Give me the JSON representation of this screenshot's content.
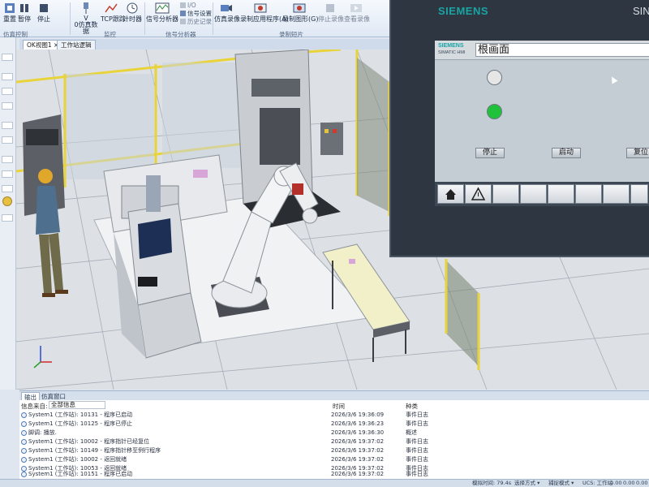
{
  "ribbon": {
    "buttons": [
      "重置",
      "暂停",
      "停止",
      "V\n0仿真数据",
      "TCP跟踪",
      "计时器",
      "信号分析器",
      "仿真录像",
      "录制应用程序(A)",
      "录制图形(G)",
      "停止录像",
      "查看录像"
    ],
    "small_items": [
      "I/O",
      "信号设置",
      "历史记录"
    ],
    "groups": [
      "仿真控制",
      "监控",
      "信号分析器",
      "录制短片"
    ]
  },
  "tabs": {
    "view": "OK视图1",
    "logic": "工作站逻辑"
  },
  "hmi": {
    "brand": "SIEMENS",
    "brand_right": "SIN",
    "logo": "SIEMENS",
    "logo_sub": "SIMATIC HMI",
    "title": "根画面",
    "buttons": [
      "停止",
      "启动",
      "复位"
    ],
    "lamps": [
      "off",
      "on"
    ]
  },
  "output": {
    "tabs": [
      "输出",
      "仿真窗口"
    ],
    "source_label": "信息来自:",
    "source_value": "全部信息",
    "col_time": "时间",
    "col_kind": "种类",
    "rows": [
      {
        "msg": "System1 (工作站): 10131 - 程序已启动",
        "time": "2026/3/6 19:36:09",
        "kind": "事件日志"
      },
      {
        "msg": "System1 (工作站): 10125 - 程序已停止",
        "time": "2026/3/6 19:36:23",
        "kind": "事件日志"
      },
      {
        "msg": "脚调: 播放.",
        "time": "2026/3/6 19:36:30",
        "kind": "概述"
      },
      {
        "msg": "System1 (工作站): 10002 - 程序指针已经复位",
        "time": "2026/3/6 19:37:02",
        "kind": "事件日志"
      },
      {
        "msg": "System1 (工作站): 10149 - 程序指针移至例行程序",
        "time": "2026/3/6 19:37:02",
        "kind": "事件日志"
      },
      {
        "msg": "System1 (工作站): 10002 - 返回就绪",
        "time": "2026/3/6 19:37:02",
        "kind": "事件日志"
      },
      {
        "msg": "System1 (工作站): 10053 - 返回就绪",
        "time": "2026/3/6 19:37:02",
        "kind": "事件日志"
      },
      {
        "msg": "System1 (工作站): 10151 - 程序已启动",
        "time": "2026/3/6 19:37:02",
        "kind": "事件日志"
      }
    ]
  },
  "status": {
    "sim_time": "模拟时间: 79.4s",
    "select_mode": "选择方式 ▾",
    "capture_mode": "捕捉模式 ▾",
    "ucs": "UCS: 工作站",
    "x": "0.00",
    "y": "0.00",
    "z": "0.00"
  },
  "colors": {
    "fence": "#e8d43a",
    "lamp_on": "#1fc23a",
    "lamp_off": "#e6e6e6",
    "siemens_teal": "#19a4a4"
  }
}
